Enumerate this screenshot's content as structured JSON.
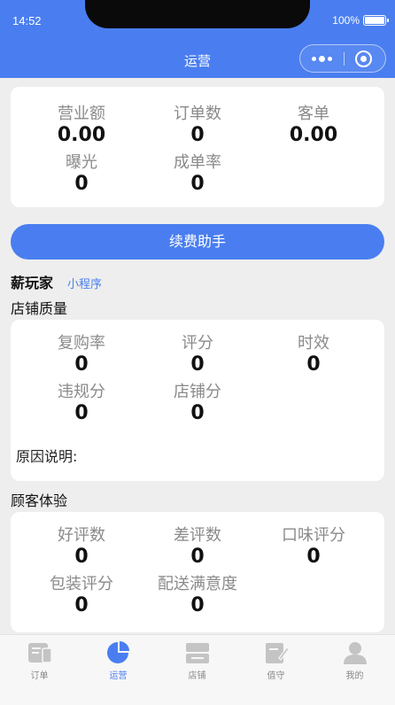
{
  "status": {
    "time": "14:52",
    "battery": "100%"
  },
  "nav": {
    "title": "运营"
  },
  "overview": [
    {
      "label": "营业额",
      "value": "0.00"
    },
    {
      "label": "订单数",
      "value": "0"
    },
    {
      "label": "客单",
      "value": "0.00"
    },
    {
      "label": "曝光",
      "value": "0"
    },
    {
      "label": "成单率",
      "value": "0"
    }
  ],
  "renew_button": "续费助手",
  "shop": {
    "name": "薪玩家",
    "tag": "小程序"
  },
  "quality": {
    "title": "店铺质量",
    "stats": [
      {
        "label": "复购率",
        "value": "0"
      },
      {
        "label": "评分",
        "value": "0"
      },
      {
        "label": "时效",
        "value": "0"
      },
      {
        "label": "违规分",
        "value": "0"
      },
      {
        "label": "店铺分",
        "value": "0"
      }
    ],
    "reason_label": "原因说明:"
  },
  "experience": {
    "title": "顾客体验",
    "stats": [
      {
        "label": "好评数",
        "value": "0"
      },
      {
        "label": "差评数",
        "value": "0"
      },
      {
        "label": "口味评分",
        "value": "0"
      },
      {
        "label": "包装评分",
        "value": "0"
      },
      {
        "label": "配送满意度",
        "value": "0"
      }
    ]
  },
  "tabs": [
    {
      "label": "订单",
      "icon": "order-icon"
    },
    {
      "label": "运营",
      "icon": "pie-chart-icon",
      "active": true
    },
    {
      "label": "店铺",
      "icon": "shop-icon"
    },
    {
      "label": "值守",
      "icon": "duty-icon"
    },
    {
      "label": "我的",
      "icon": "user-icon"
    }
  ],
  "colors": {
    "primary": "#4a7ef0",
    "background": "#eeeeee",
    "tab_inactive": "#c4c4c4"
  }
}
